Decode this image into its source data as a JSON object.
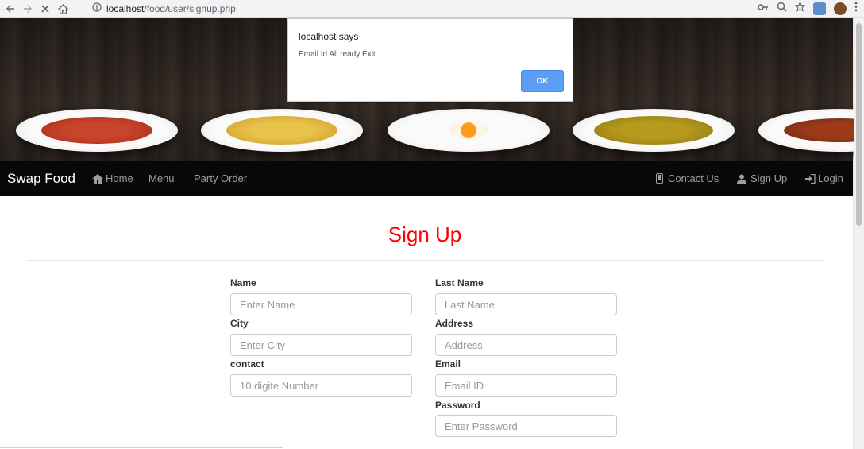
{
  "browser": {
    "url": "localhost/food/user/signup.php",
    "url_host": "localhost",
    "url_path": "/food/user/signup.php"
  },
  "alert": {
    "title": "localhost says",
    "message": "Email Id All ready Exit",
    "ok_label": "OK"
  },
  "navbar": {
    "brand": "Swap Food",
    "left_items": [
      "Home",
      "Menu",
      "Party Order"
    ],
    "right_items": [
      "Contact Us",
      "Sign Up",
      "Login"
    ]
  },
  "page": {
    "title": "Sign Up",
    "title_color": "#ff0000"
  },
  "form": {
    "name": {
      "label": "Name",
      "placeholder": "Enter Name"
    },
    "last_name": {
      "label": "Last Name",
      "placeholder": "Last Name"
    },
    "city": {
      "label": "City",
      "placeholder": "Enter City"
    },
    "address": {
      "label": "Address",
      "placeholder": "Address"
    },
    "contact": {
      "label": "contact",
      "placeholder": "10 digite Number"
    },
    "email": {
      "label": "Email",
      "placeholder": "Email ID"
    },
    "password": {
      "label": "Password",
      "placeholder": "Enter Password"
    }
  },
  "colors": {
    "navbar_bg": "#080808",
    "alert_ok": "#5b9ef5"
  }
}
